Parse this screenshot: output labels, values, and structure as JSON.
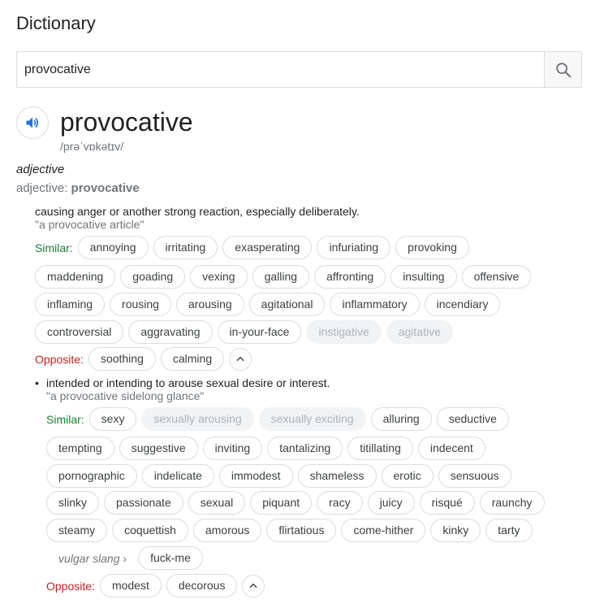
{
  "title": "Dictionary",
  "search": {
    "value": "provocative"
  },
  "entry": {
    "word": "provocative",
    "phonetic": "/prəˈvɒkətɪv/",
    "pos": "adjective",
    "inflection_label": "adjective:",
    "inflection_word": "provocative"
  },
  "sense1": {
    "definition": "causing anger or another strong reaction, especially deliberately.",
    "example": "\"a provocative article\"",
    "similar_label": "Similar:",
    "similar_rows": [
      [
        "annoying",
        "irritating",
        "exasperating",
        "infuriating",
        "provoking"
      ],
      [
        "maddening",
        "goading",
        "vexing",
        "galling",
        "affronting",
        "insulting",
        "offensive"
      ],
      [
        "inflaming",
        "rousing",
        "arousing",
        "agitational",
        "inflammatory",
        "incendiary"
      ],
      [
        "controversial",
        "aggravating",
        "in-your-face",
        "instigative",
        "agitative"
      ]
    ],
    "opposite_label": "Opposite:",
    "opposites": [
      "soothing",
      "calming"
    ]
  },
  "sense2": {
    "bullet": "•",
    "definition": "intended or intending to arouse sexual desire or interest.",
    "example": "\"a provocative sidelong glance\"",
    "similar_label": "Similar:",
    "similar_rows": [
      [
        "sexy",
        "sexually arousing",
        "sexually exciting",
        "alluring",
        "seductive"
      ],
      [
        "tempting",
        "suggestive",
        "inviting",
        "tantalizing",
        "titillating",
        "indecent"
      ],
      [
        "pornographic",
        "indelicate",
        "immodest",
        "shameless",
        "erotic",
        "sensuous"
      ],
      [
        "slinky",
        "passionate",
        "sexual",
        "piquant",
        "racy",
        "juicy",
        "risqué",
        "raunchy"
      ],
      [
        "steamy",
        "coquettish",
        "amorous",
        "flirtatious",
        "come-hither",
        "kinky",
        "tarty"
      ]
    ],
    "vulgar_label": "vulgar slang",
    "vulgar_arrow": "›",
    "vulgar_words": [
      "fuck-me"
    ],
    "opposite_label": "Opposite:",
    "opposites": [
      "modest",
      "decorous"
    ]
  },
  "faded_words": [
    "instigative",
    "agitative",
    "sexually arousing",
    "sexually exciting"
  ],
  "colors": {
    "similar": "#188038",
    "opposite": "#c5221f",
    "speaker": "#1a73e8"
  },
  "icons": {
    "search": "search-icon",
    "speaker": "speaker-icon",
    "collapse": "chevron-up-icon"
  }
}
